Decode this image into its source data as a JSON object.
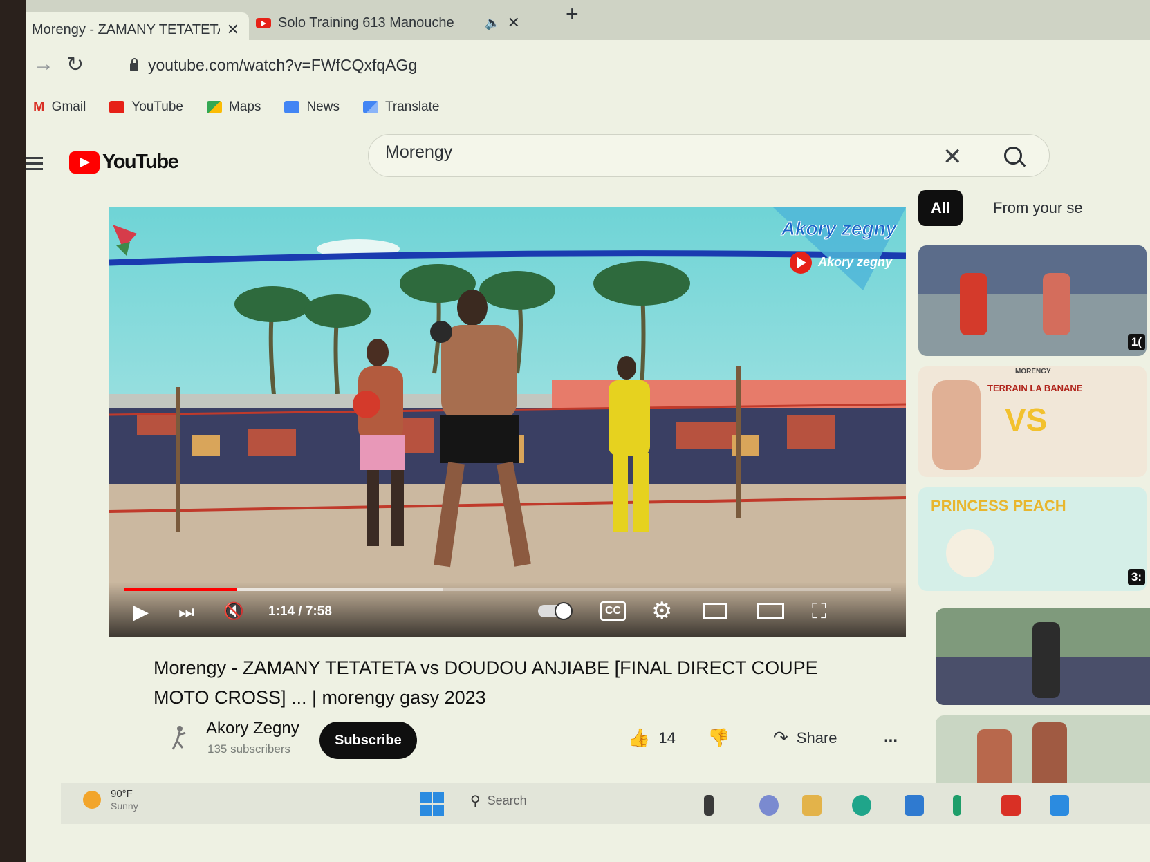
{
  "browser": {
    "tabs": [
      {
        "title": "Morengy - ZAMANY TETATETA v",
        "active": true,
        "close_icon": "close-icon"
      },
      {
        "title": "Solo Training 613 Manouche",
        "active": false,
        "audio_icon": "speaker-icon",
        "close_icon": "close-icon"
      }
    ],
    "new_tab_icon": "plus-icon",
    "url": "youtube.com/watch?v=FWfCQxfqAGg",
    "bookmarks": [
      {
        "label": "Gmail",
        "icon": "gmail-icon",
        "color": "#d93025"
      },
      {
        "label": "YouTube",
        "icon": "youtube-icon",
        "color": "#e62117"
      },
      {
        "label": "Maps",
        "icon": "maps-icon",
        "color": "#34a853"
      },
      {
        "label": "News",
        "icon": "news-icon",
        "color": "#4285f4"
      },
      {
        "label": "Translate",
        "icon": "translate-icon",
        "color": "#4285f4"
      }
    ]
  },
  "youtube": {
    "logo_text": "YouTube",
    "search_value": "Morengy",
    "search_placeholder": "Search",
    "brand_color": "#ff0000"
  },
  "player": {
    "watermark_large": "Akory zegny",
    "watermark_small": "Akory zegny",
    "current_time": "1:14",
    "duration": "7:58",
    "time_display": "1:14 / 7:58",
    "played_fraction": 0.147,
    "buffered_fraction": 0.415,
    "muted": true,
    "autoplay_on": true,
    "cc_label": "CC"
  },
  "video": {
    "title_line1": "Morengy - ZAMANY TETATETA vs DOUDOU ANJIABE [FINAL DIRECT COUPE",
    "title_line2": "MOTO CROSS] ... | morengy gasy 2023",
    "channel_name": "Akory Zegny",
    "subscribers": "135 subscribers",
    "subscribe_label": "Subscribe",
    "likes": "14",
    "share_label": "Share",
    "more_label": "..."
  },
  "sidebar": {
    "chips": [
      {
        "label": "All",
        "active": true
      },
      {
        "label": "From your se",
        "active": false
      }
    ],
    "thumbnails": [
      {
        "duration": "1("
      },
      {
        "title_text": "TERRAIN LA BANANE",
        "vs_text": "VS",
        "brand_text": "MORENGY"
      },
      {
        "duration": "3:",
        "title_text": "PRINCESS PEACH"
      },
      {},
      {}
    ]
  },
  "taskbar": {
    "weather_temp": "90°F",
    "weather_condition": "Sunny",
    "search_label": "Search"
  }
}
